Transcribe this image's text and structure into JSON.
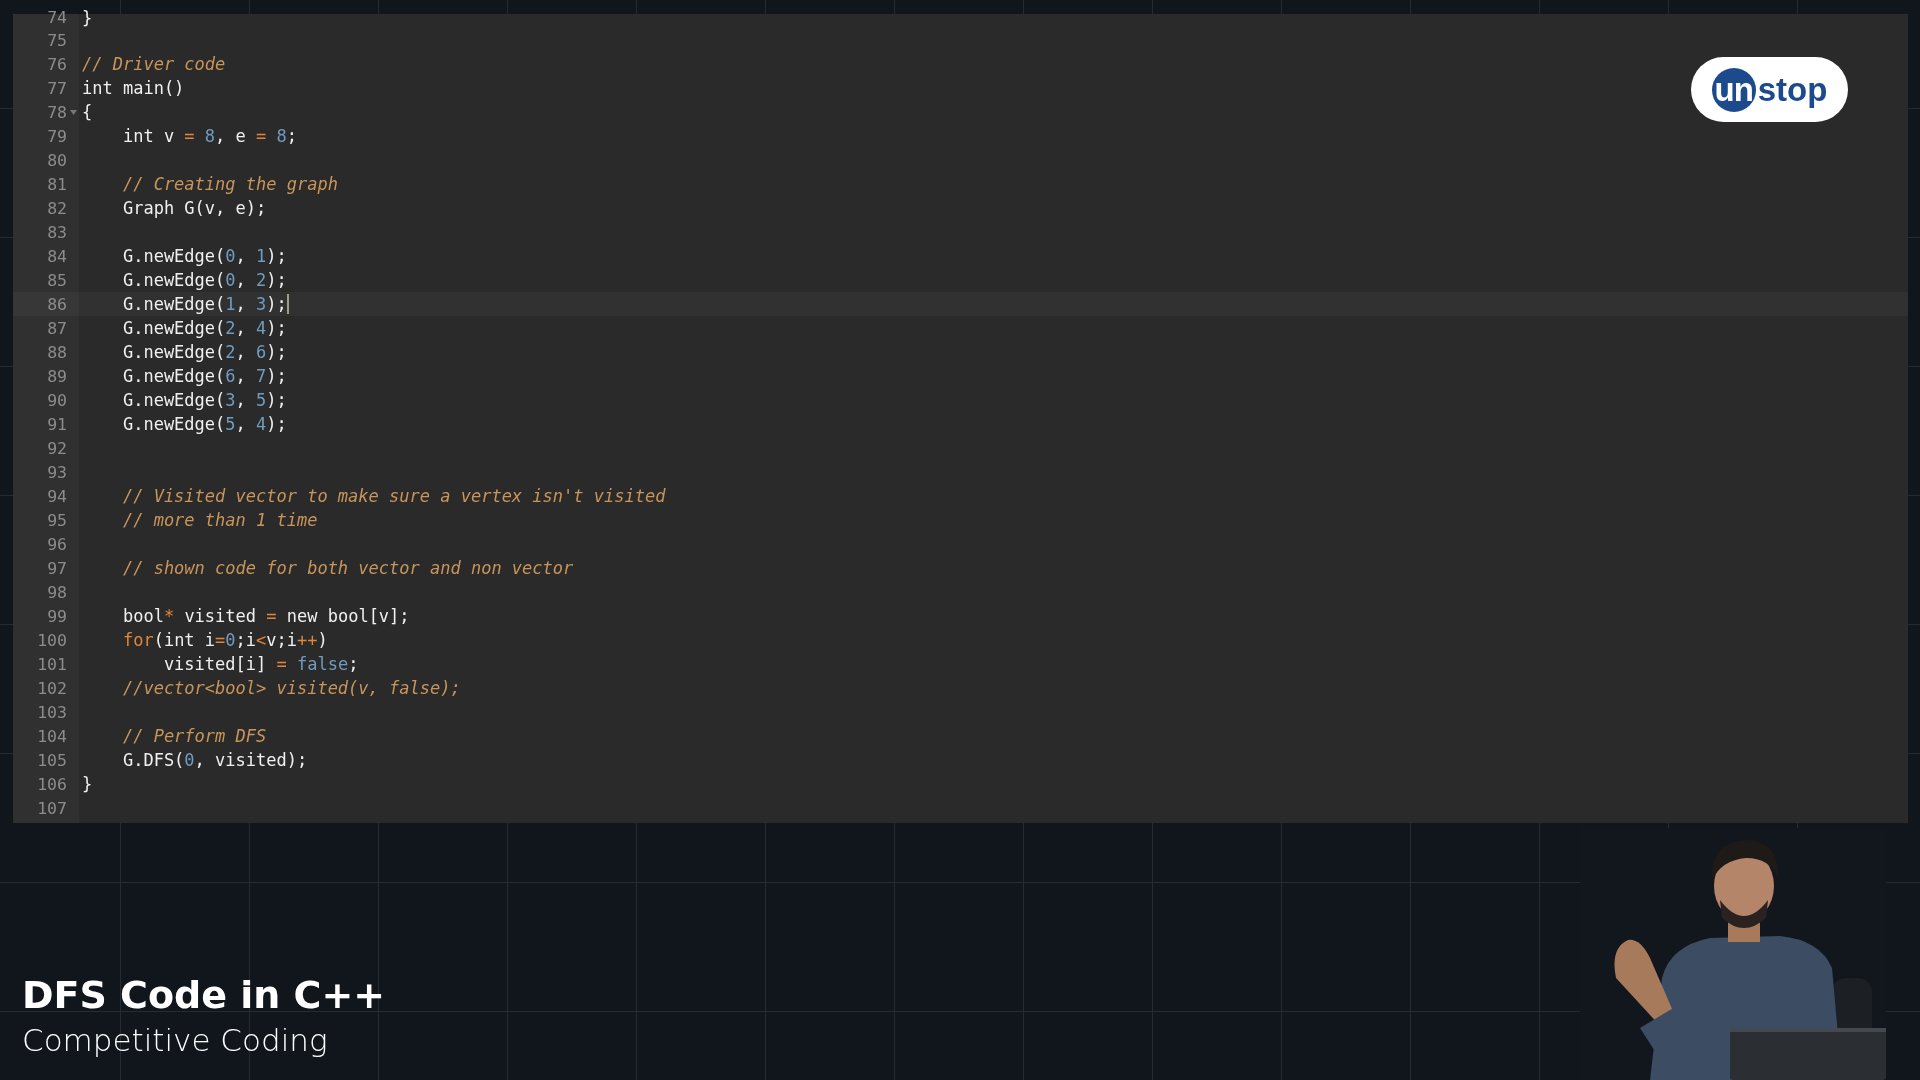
{
  "editor": {
    "lines": [
      {
        "n": "74",
        "code": [
          {
            "kind": "plain",
            "text": "}"
          }
        ],
        "fold": false,
        "active": false
      },
      {
        "n": "75",
        "fold": false,
        "active": false
      },
      {
        "n": "76",
        "code": [
          {
            "kind": "comment",
            "text": "// Driver code"
          }
        ],
        "fold": false,
        "active": false
      },
      {
        "n": "77",
        "code": [
          {
            "kind": "plain",
            "text": "int main()"
          }
        ],
        "fold": false,
        "active": false
      },
      {
        "n": "78",
        "code": [
          {
            "kind": "plain",
            "text": "{"
          }
        ],
        "fold": true,
        "active": false
      },
      {
        "n": "79",
        "code": [
          {
            "kind": "plain",
            "text": "    int v"
          },
          {
            "kind": "op",
            "text": " = "
          },
          {
            "kind": "num",
            "text": "8"
          },
          {
            "kind": "plain",
            "text": ", e"
          },
          {
            "kind": "op",
            "text": " = "
          },
          {
            "kind": "num",
            "text": "8"
          },
          {
            "kind": "plain",
            "text": ";"
          }
        ],
        "fold": false,
        "active": false
      },
      {
        "n": "80",
        "fold": false,
        "active": false
      },
      {
        "n": "81",
        "code": [
          {
            "kind": "comment",
            "text": "    // Creating the graph"
          }
        ],
        "fold": false,
        "active": false
      },
      {
        "n": "82",
        "code": [
          {
            "kind": "plain",
            "text": "    Graph G(v, e);"
          }
        ],
        "fold": false,
        "active": false
      },
      {
        "n": "83",
        "fold": false,
        "active": false
      },
      {
        "n": "84",
        "code": [
          {
            "kind": "plain",
            "text": "    G.newEdge("
          },
          {
            "kind": "num",
            "text": "0"
          },
          {
            "kind": "plain",
            "text": ", "
          },
          {
            "kind": "num",
            "text": "1"
          },
          {
            "kind": "plain",
            "text": ");"
          }
        ],
        "fold": false,
        "active": false
      },
      {
        "n": "85",
        "code": [
          {
            "kind": "plain",
            "text": "    G.newEdge("
          },
          {
            "kind": "num",
            "text": "0"
          },
          {
            "kind": "plain",
            "text": ", "
          },
          {
            "kind": "num",
            "text": "2"
          },
          {
            "kind": "plain",
            "text": ");"
          }
        ],
        "fold": false,
        "active": false
      },
      {
        "n": "86",
        "code": [
          {
            "kind": "plain",
            "text": "    G.newEdge("
          },
          {
            "kind": "num",
            "text": "1"
          },
          {
            "kind": "plain",
            "text": ", "
          },
          {
            "kind": "num",
            "text": "3"
          },
          {
            "kind": "plain",
            "text": ");"
          }
        ],
        "fold": false,
        "active": true
      },
      {
        "n": "87",
        "code": [
          {
            "kind": "plain",
            "text": "    G.newEdge("
          },
          {
            "kind": "num",
            "text": "2"
          },
          {
            "kind": "plain",
            "text": ", "
          },
          {
            "kind": "num",
            "text": "4"
          },
          {
            "kind": "plain",
            "text": ");"
          }
        ],
        "fold": false,
        "active": false
      },
      {
        "n": "88",
        "code": [
          {
            "kind": "plain",
            "text": "    G.newEdge("
          },
          {
            "kind": "num",
            "text": "2"
          },
          {
            "kind": "plain",
            "text": ", "
          },
          {
            "kind": "num",
            "text": "6"
          },
          {
            "kind": "plain",
            "text": ");"
          }
        ],
        "fold": false,
        "active": false
      },
      {
        "n": "89",
        "code": [
          {
            "kind": "plain",
            "text": "    G.newEdge("
          },
          {
            "kind": "num",
            "text": "6"
          },
          {
            "kind": "plain",
            "text": ", "
          },
          {
            "kind": "num",
            "text": "7"
          },
          {
            "kind": "plain",
            "text": ");"
          }
        ],
        "fold": false,
        "active": false
      },
      {
        "n": "90",
        "code": [
          {
            "kind": "plain",
            "text": "    G.newEdge("
          },
          {
            "kind": "num",
            "text": "3"
          },
          {
            "kind": "plain",
            "text": ", "
          },
          {
            "kind": "num",
            "text": "5"
          },
          {
            "kind": "plain",
            "text": ");"
          }
        ],
        "fold": false,
        "active": false
      },
      {
        "n": "91",
        "code": [
          {
            "kind": "plain",
            "text": "    G.newEdge("
          },
          {
            "kind": "num",
            "text": "5"
          },
          {
            "kind": "plain",
            "text": ", "
          },
          {
            "kind": "num",
            "text": "4"
          },
          {
            "kind": "plain",
            "text": ");"
          }
        ],
        "fold": false,
        "active": false
      },
      {
        "n": "92",
        "fold": false,
        "active": false
      },
      {
        "n": "93",
        "fold": false,
        "active": false
      },
      {
        "n": "94",
        "code": [
          {
            "kind": "comment",
            "text": "    // Visited vector to make sure a vertex isn't visited"
          }
        ],
        "fold": false,
        "active": false
      },
      {
        "n": "95",
        "code": [
          {
            "kind": "comment",
            "text": "    // more than 1 time"
          }
        ],
        "fold": false,
        "active": false
      },
      {
        "n": "96",
        "fold": false,
        "active": false
      },
      {
        "n": "97",
        "code": [
          {
            "kind": "comment",
            "text": "    // shown code for both vector and non vector"
          }
        ],
        "fold": false,
        "active": false
      },
      {
        "n": "98",
        "fold": false,
        "active": false
      },
      {
        "n": "99",
        "code": [
          {
            "kind": "plain",
            "text": "    bool"
          },
          {
            "kind": "op",
            "text": "*"
          },
          {
            "kind": "plain",
            "text": " visited"
          },
          {
            "kind": "op",
            "text": " = "
          },
          {
            "kind": "plain",
            "text": "new bool[v];"
          }
        ],
        "fold": false,
        "active": false
      },
      {
        "n": "100",
        "code": [
          {
            "kind": "keyword",
            "text": "    for"
          },
          {
            "kind": "plain",
            "text": "(int i"
          },
          {
            "kind": "op",
            "text": "="
          },
          {
            "kind": "num",
            "text": "0"
          },
          {
            "kind": "plain",
            "text": ";i"
          },
          {
            "kind": "op",
            "text": "<"
          },
          {
            "kind": "plain",
            "text": "v;i"
          },
          {
            "kind": "op",
            "text": "++"
          },
          {
            "kind": "plain",
            "text": ")"
          }
        ],
        "fold": false,
        "active": false
      },
      {
        "n": "101",
        "code": [
          {
            "kind": "plain",
            "text": "        visited[i]"
          },
          {
            "kind": "op",
            "text": " = "
          },
          {
            "kind": "num",
            "text": "false"
          },
          {
            "kind": "plain",
            "text": ";"
          }
        ],
        "fold": false,
        "active": false
      },
      {
        "n": "102",
        "code": [
          {
            "kind": "comment",
            "text": "    //vector<bool> visited(v, false);"
          }
        ],
        "fold": false,
        "active": false
      },
      {
        "n": "103",
        "fold": false,
        "active": false
      },
      {
        "n": "104",
        "code": [
          {
            "kind": "comment",
            "text": "    // Perform DFS"
          }
        ],
        "fold": false,
        "active": false
      },
      {
        "n": "105",
        "code": [
          {
            "kind": "plain",
            "text": "    G.DFS("
          },
          {
            "kind": "num",
            "text": "0"
          },
          {
            "kind": "plain",
            "text": ", visited);"
          }
        ],
        "fold": false,
        "active": false
      },
      {
        "n": "106",
        "code": [
          {
            "kind": "plain",
            "text": "}"
          }
        ],
        "fold": false,
        "active": false
      },
      {
        "n": "107",
        "fold": false,
        "active": false
      }
    ]
  },
  "logo": {
    "mark": "un",
    "text": "stop"
  },
  "caption": {
    "title": "DFS Code in C++",
    "subtitle": "Competitive Coding"
  }
}
